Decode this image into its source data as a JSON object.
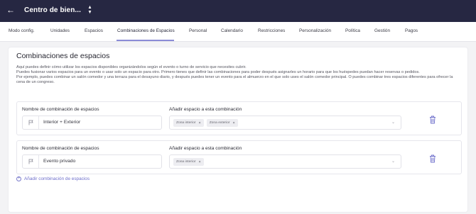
{
  "header": {
    "back_icon": "arrow-left-icon",
    "venue": "Centro de bien...",
    "venue_icon": "updown-chevron-icon"
  },
  "tabs": [
    {
      "label": "Modo config.",
      "active": false
    },
    {
      "label": "Unidades",
      "active": false
    },
    {
      "label": "Espacios",
      "active": false
    },
    {
      "label": "Combinaciones de Espacios",
      "active": true
    },
    {
      "label": "Personal",
      "active": false
    },
    {
      "label": "Calendario",
      "active": false
    },
    {
      "label": "Restricciones",
      "active": false
    },
    {
      "label": "Personalización",
      "active": false
    },
    {
      "label": "Política",
      "active": false
    },
    {
      "label": "Gestión",
      "active": false
    },
    {
      "label": "Pagos",
      "active": false
    }
  ],
  "accent_color": "#7b7ccc",
  "topbar_color": "#262742",
  "section": {
    "title": "Combinaciones de espacios",
    "description_1": "Aquí puedes definir cómo utilizar los espacios disponibles organizándolos según el evento o turno de servicio que necesites cubrir.",
    "description_2": "Puedes fusionar varios espacios para un evento o usar solo un espacio para otro. Primero tienes que definir las combinaciones para poder después asignarles un horario para que los huéspedes puedan hacer reservas o pedidos.",
    "description_3": "Por ejemplo, puedes combinar un salón comedor y una terraza para el desayuno diario, y después puedes tener un evento para el almuerzo en el que solo uses el salón comedor principal. O puedes combinar tres espacios diferentes para ofrecer la cena de un congreso."
  },
  "combinations": [
    {
      "name_label": "Nombre de combinación de espacios",
      "name_value": "Interior + Exterior",
      "spaces_label": "Añadir espacio a esta combinación",
      "spaces": [
        "Zona interior",
        "Zona exterior"
      ]
    },
    {
      "name_label": "Nombre de combinación de espacios",
      "name_value": "Evento privado",
      "spaces_label": "Añadir espacio a esta combinación",
      "spaces": [
        "Zona interior"
      ]
    }
  ],
  "add_combination_label": "Añadir combinación de espacios",
  "chip_remove_glyph": "×",
  "plus_glyph": "+"
}
